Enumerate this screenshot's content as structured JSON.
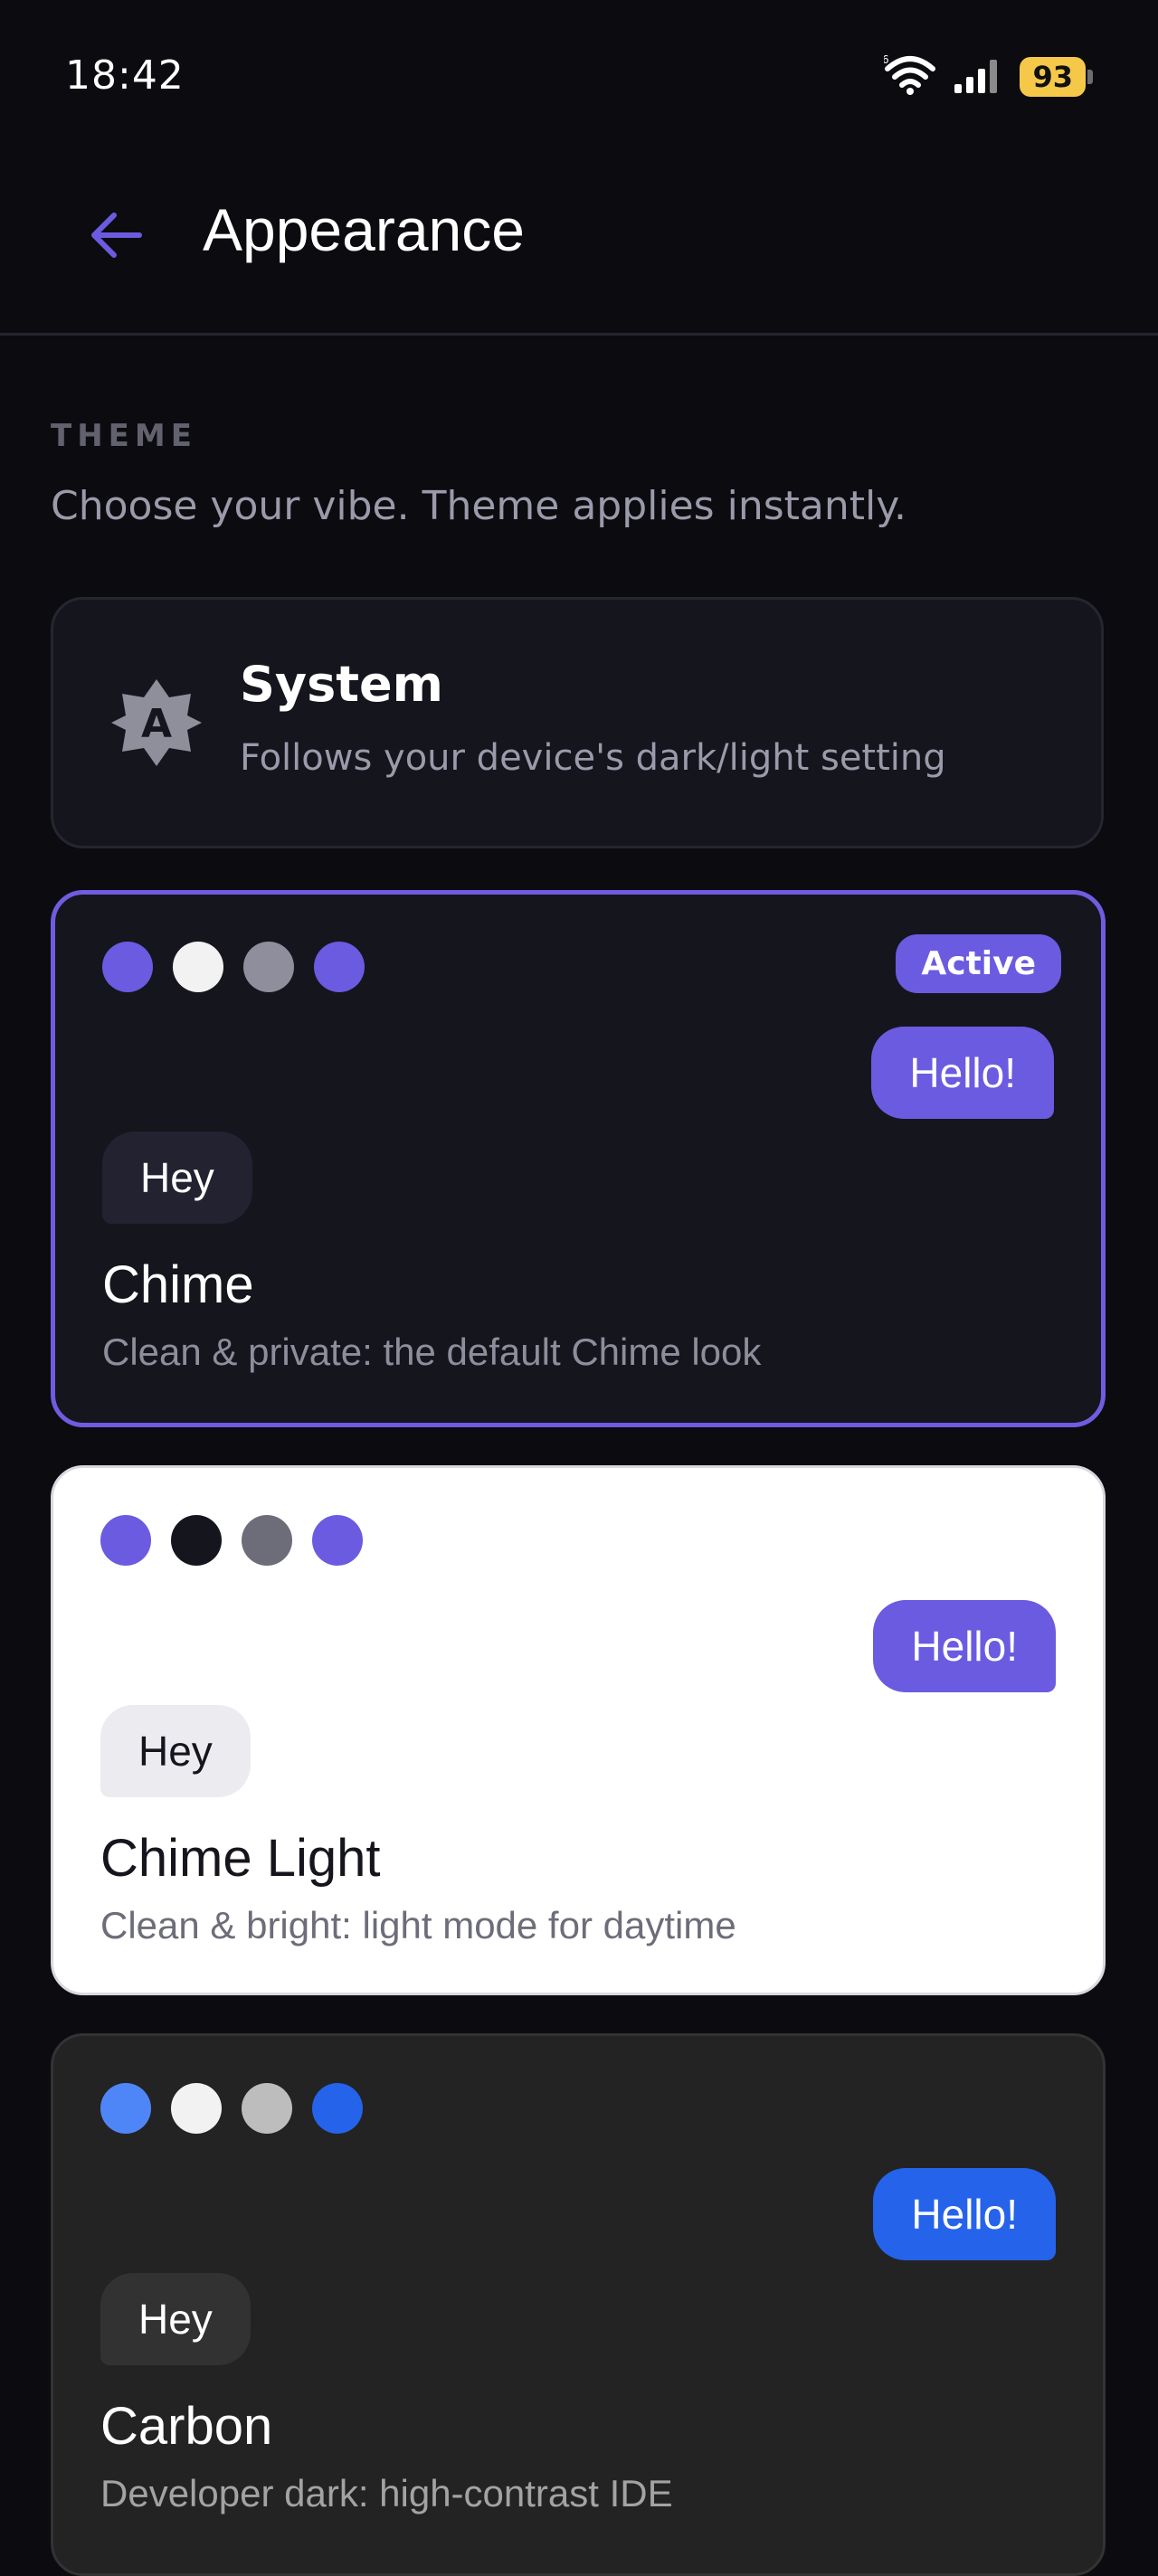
{
  "status_bar": {
    "time": "18:42",
    "battery": "93",
    "battery_color": "#f5c84a",
    "icons": [
      "wifi-6-icon",
      "signal-icon",
      "battery-icon"
    ]
  },
  "app_bar": {
    "title": "Appearance",
    "back_icon": "arrow-left-icon",
    "accent": "#6b5be0"
  },
  "section": {
    "title": "THEME",
    "subtitle": "Choose your vibe. Theme applies instantly."
  },
  "system_option": {
    "title": "System",
    "description": "Follows your device's dark/light setting",
    "icon": "auto-brightness-icon"
  },
  "themes": [
    {
      "name": "Chime",
      "description": "Clean & private: the default Chime look",
      "active": true,
      "badge": "Active",
      "bubble_out": "Hello!",
      "bubble_in": "Hey",
      "swatches": [
        "#6b5be0",
        "#f2f2f2",
        "#8e8e9c",
        "#6b5be0"
      ]
    },
    {
      "name": "Chime Light",
      "description": "Clean & bright: light mode for daytime",
      "active": false,
      "bubble_out": "Hello!",
      "bubble_in": "Hey",
      "swatches": [
        "#6b5be0",
        "#15151e",
        "#6d6d7a",
        "#6b5be0"
      ]
    },
    {
      "name": "Carbon",
      "description": "Developer dark: high-contrast IDE",
      "active": false,
      "bubble_out": "Hello!",
      "bubble_in": "Hey",
      "swatches": [
        "#4f86f7",
        "#f2f2f2",
        "#bdbdbd",
        "#2563eb"
      ]
    }
  ]
}
